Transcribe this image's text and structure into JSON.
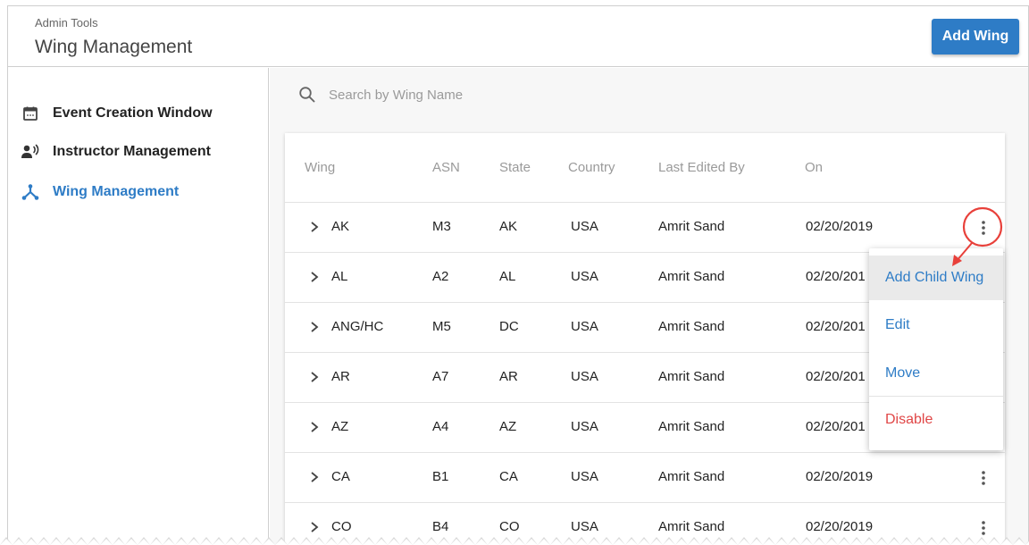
{
  "header": {
    "breadcrumb": "Admin Tools",
    "title": "Wing Management",
    "add_button_label": "Add Wing"
  },
  "sidebar": {
    "items": [
      {
        "label": "Event Creation Window",
        "icon": "calendar-icon",
        "active": false
      },
      {
        "label": "Instructor Management",
        "icon": "speaking-person-icon",
        "active": false
      },
      {
        "label": "Wing Management",
        "icon": "hierarchy-icon",
        "active": true
      }
    ]
  },
  "search": {
    "placeholder": "Search by Wing Name",
    "value": ""
  },
  "table": {
    "columns": [
      "Wing",
      "ASN",
      "State",
      "Country",
      "Last Edited By",
      "On"
    ],
    "rows": [
      {
        "wing": "AK",
        "asn": "M3",
        "state": "AK",
        "country": "USA",
        "editor": "Amrit Sand",
        "on": "02/20/2019"
      },
      {
        "wing": "AL",
        "asn": "A2",
        "state": "AL",
        "country": "USA",
        "editor": "Amrit Sand",
        "on": "02/20/201"
      },
      {
        "wing": "ANG/HC",
        "asn": "M5",
        "state": "DC",
        "country": "USA",
        "editor": "Amrit Sand",
        "on": "02/20/201"
      },
      {
        "wing": "AR",
        "asn": "A7",
        "state": "AR",
        "country": "USA",
        "editor": "Amrit Sand",
        "on": "02/20/201"
      },
      {
        "wing": "AZ",
        "asn": "A4",
        "state": "AZ",
        "country": "USA",
        "editor": "Amrit Sand",
        "on": "02/20/201"
      },
      {
        "wing": "CA",
        "asn": "B1",
        "state": "CA",
        "country": "USA",
        "editor": "Amrit Sand",
        "on": "02/20/2019"
      },
      {
        "wing": "CO",
        "asn": "B4",
        "state": "CO",
        "country": "USA",
        "editor": "Amrit Sand",
        "on": "02/20/2019"
      }
    ]
  },
  "row_menu": {
    "items": [
      {
        "label": "Add Child Wing",
        "tone": "primary",
        "highlighted": true
      },
      {
        "label": "Edit",
        "tone": "primary",
        "highlighted": false
      },
      {
        "label": "Move",
        "tone": "primary",
        "highlighted": false
      },
      {
        "label": "Disable",
        "tone": "danger",
        "highlighted": false
      }
    ]
  },
  "colors": {
    "accent": "#2e7cc6",
    "danger": "#e04646",
    "annotation": "#e8403a"
  }
}
